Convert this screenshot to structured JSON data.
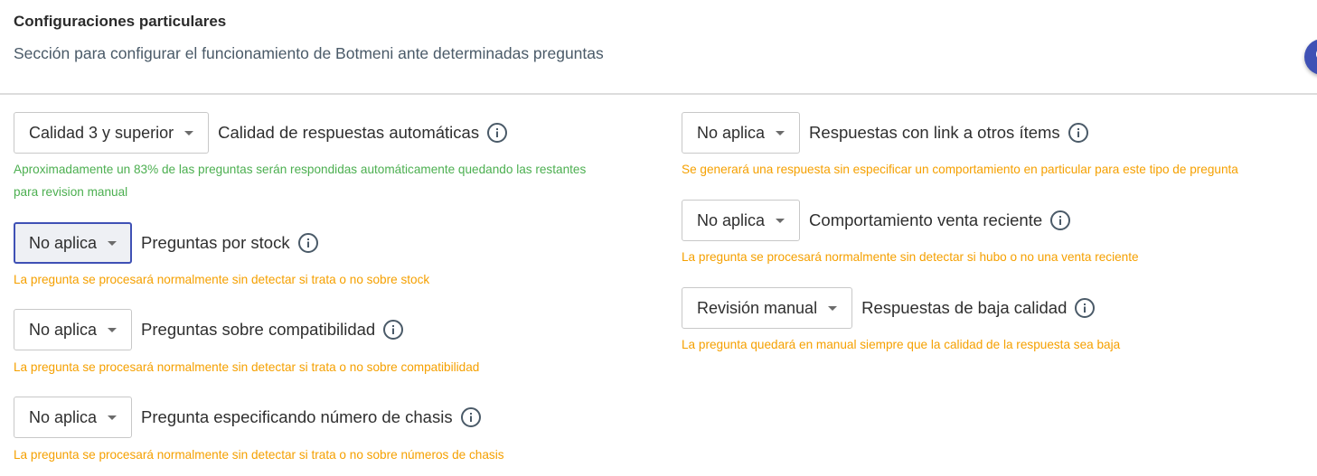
{
  "header": {
    "title": "Configuraciones particulares",
    "subtitle": "Sección para configurar el funcionamiento de Botmeni ante determinadas preguntas"
  },
  "colors": {
    "accent": "#3f51b5",
    "help_green": "#4caf50",
    "help_orange": "#f5a000"
  },
  "settings": {
    "left": [
      {
        "value": "Calidad 3 y superior",
        "label": "Calidad de respuestas automáticas",
        "help_line1": "Aproximadamente un 83% de las preguntas serán respondidas automáticamente quedando las restantes",
        "help_line2": "para revision manual"
      },
      {
        "value": "No aplica",
        "label": "Preguntas por stock",
        "help": "La pregunta se procesará normalmente sin detectar si trata o no sobre stock"
      },
      {
        "value": "No aplica",
        "label": "Preguntas sobre compatibilidad",
        "help": "La pregunta se procesará normalmente sin detectar si trata o no sobre compatibilidad"
      },
      {
        "value": "No aplica",
        "label": "Pregunta especificando número de chasis",
        "help": "La pregunta se procesará normalmente sin detectar si trata o no sobre números de chasis"
      }
    ],
    "right": [
      {
        "value": "No aplica",
        "label": "Respuestas con link a otros ítems",
        "help": "Se generará una respuesta sin especificar un comportamiento en particular para este tipo de pregunta"
      },
      {
        "value": "No aplica",
        "label": "Comportamiento venta reciente",
        "help": "La pregunta se procesará normalmente sin detectar si hubo o no una venta reciente"
      },
      {
        "value": "Revisión manual",
        "label": "Respuestas de baja calidad",
        "help": "La pregunta quedará en manual siempre que la calidad de la respuesta sea baja"
      }
    ]
  }
}
